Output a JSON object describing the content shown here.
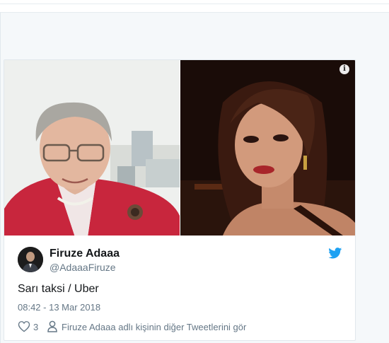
{
  "tweet": {
    "display_name": "Firuze Adaaa",
    "handle": "@AdaaaFiruze",
    "text": "Sarı taksi / Uber",
    "timestamp": "08:42 - 13 Mar 2018",
    "like_count": "3",
    "see_others_label": "Firuze Adaaa adlı kişinin diğer Tweetlerini gör"
  },
  "icons": {
    "info": "info-icon",
    "twitter_bird": "twitter-bird-icon",
    "like": "heart-icon",
    "profile": "person-icon"
  },
  "colors": {
    "twitter_blue": "#1da1f2",
    "secondary_text": "#657786",
    "primary_text": "#14171a"
  }
}
